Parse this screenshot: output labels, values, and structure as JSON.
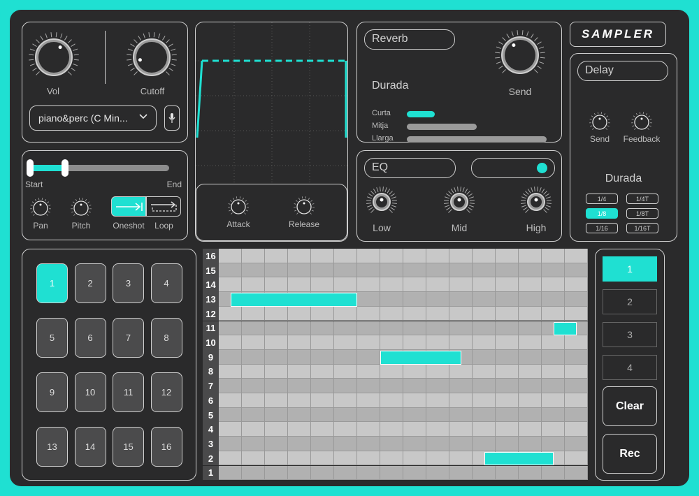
{
  "app": {
    "logo": "SAMPLER"
  },
  "sample": {
    "vol_label": "Vol",
    "cutoff_label": "Cutoff",
    "preset": "piano&perc (C Min...",
    "start_label": "Start",
    "end_label": "End",
    "pan_label": "Pan",
    "pitch_label": "Pitch",
    "oneshot_label": "Oneshot",
    "loop_label": "Loop"
  },
  "envelope": {
    "attack_label": "Attack",
    "release_label": "Release"
  },
  "reverb": {
    "title": "Reverb",
    "send_label": "Send",
    "duration_title": "Durada",
    "options": [
      {
        "label": "Curta",
        "level": 0.2
      },
      {
        "label": "Mitja",
        "level": 0.5
      },
      {
        "label": "Llarga",
        "level": 1.0
      }
    ]
  },
  "eq": {
    "title": "EQ",
    "low_label": "Low",
    "mid_label": "Mid",
    "high_label": "High",
    "enabled": true
  },
  "delay": {
    "title": "Delay",
    "send_label": "Send",
    "feedback_label": "Feedback",
    "duration_title": "Durada",
    "divisions": [
      "1/4",
      "1/4T",
      "1/8",
      "1/8T",
      "1/16",
      "1/16T"
    ],
    "selected_division": "1/8"
  },
  "pads": {
    "labels": [
      "1",
      "2",
      "3",
      "4",
      "5",
      "6",
      "7",
      "8",
      "9",
      "10",
      "11",
      "12",
      "13",
      "14",
      "15",
      "16"
    ],
    "active": "1"
  },
  "sequencer": {
    "rows": [
      "16",
      "15",
      "14",
      "13",
      "12",
      "11",
      "10",
      "9",
      "8",
      "7",
      "6",
      "5",
      "4",
      "3",
      "2",
      "1"
    ],
    "steps": 16,
    "notes": [
      {
        "row": "13",
        "start": 0.5,
        "length": 5.5
      },
      {
        "row": "11",
        "start": 14.5,
        "length": 1
      },
      {
        "row": "9",
        "start": 7,
        "length": 3.5
      },
      {
        "row": "2",
        "start": 11.5,
        "length": 3
      }
    ]
  },
  "patterns": {
    "labels": [
      "1",
      "2",
      "3",
      "4"
    ],
    "active": "1"
  },
  "controls": {
    "clear_label": "Clear",
    "rec_label": "Rec"
  },
  "colors": {
    "accent": "#1fe0d2",
    "panel": "#2a2a2b",
    "border": "#cfcfcf"
  }
}
